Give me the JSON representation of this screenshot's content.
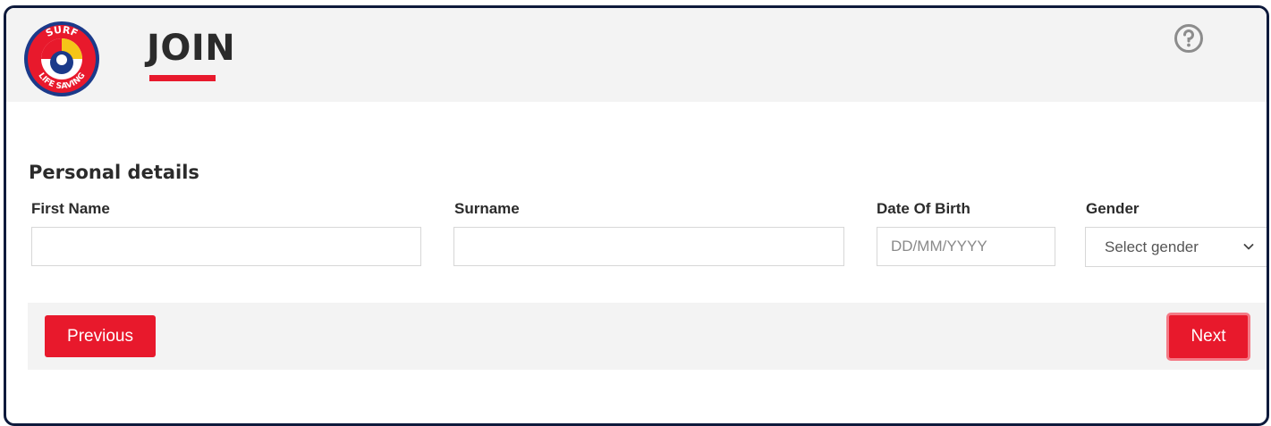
{
  "header": {
    "logo": {
      "name": "surf-life-saving-logo",
      "text_top": "SURF",
      "text_bottom": "LIFE SAVING"
    },
    "title": "JOIN",
    "help_icon": "question-circle-icon"
  },
  "form": {
    "section_title": "Personal details",
    "first_name": {
      "label": "First Name",
      "value": "",
      "placeholder": ""
    },
    "surname": {
      "label": "Surname",
      "value": "",
      "placeholder": ""
    },
    "dob": {
      "label": "Date Of Birth",
      "value": "",
      "placeholder": "DD/MM/YYYY"
    },
    "gender": {
      "label": "Gender",
      "selected": "Select gender",
      "icon": "chevron-down-icon"
    }
  },
  "actions": {
    "previous_label": "Previous",
    "next_label": "Next"
  },
  "colors": {
    "accent": "#e8192c",
    "frame_border": "#0e1a3c",
    "header_bg": "#f3f3f3",
    "text": "#2b2b2b"
  }
}
